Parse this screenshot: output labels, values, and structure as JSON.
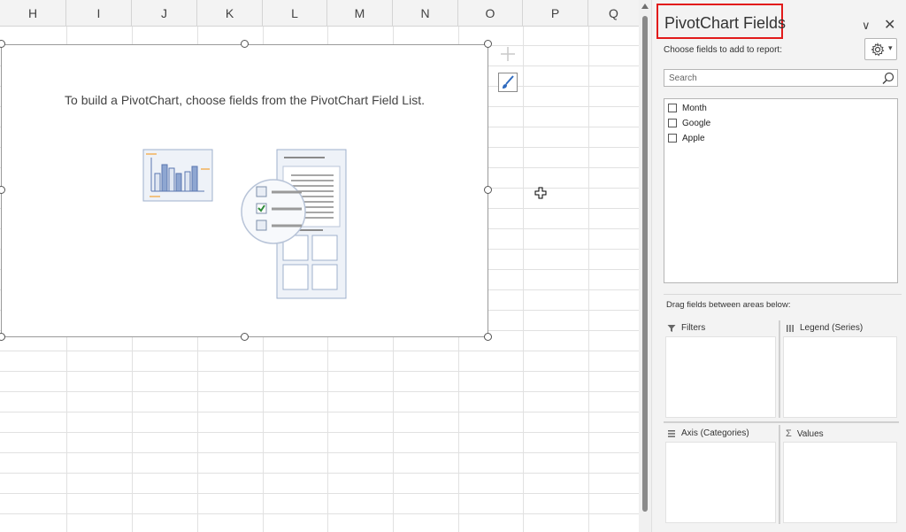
{
  "sheet": {
    "columns": [
      "H",
      "I",
      "J",
      "K",
      "L",
      "M",
      "N",
      "O",
      "P",
      "Q"
    ]
  },
  "chart": {
    "message": "To build a PivotChart, choose fields from the PivotChart Field List."
  },
  "pane": {
    "title": "PivotChart Fields",
    "choose_label": "Choose fields to add to report:",
    "search_placeholder": "Search",
    "fields": [
      {
        "label": "Month",
        "checked": false
      },
      {
        "label": "Google",
        "checked": false
      },
      {
        "label": "Apple",
        "checked": false
      }
    ],
    "drag_label": "Drag fields between areas below:",
    "areas": {
      "filters": "Filters",
      "legend": "Legend (Series)",
      "axis": "Axis (Categories)",
      "values": "Values"
    }
  },
  "colors": {
    "title_highlight": "#e21b1b",
    "chart_bar_blue": "#8ea6d1",
    "chart_bar_outline": "#5a77b0",
    "check_green": "#2e8b3a",
    "accent_orange": "#f2b35a"
  }
}
